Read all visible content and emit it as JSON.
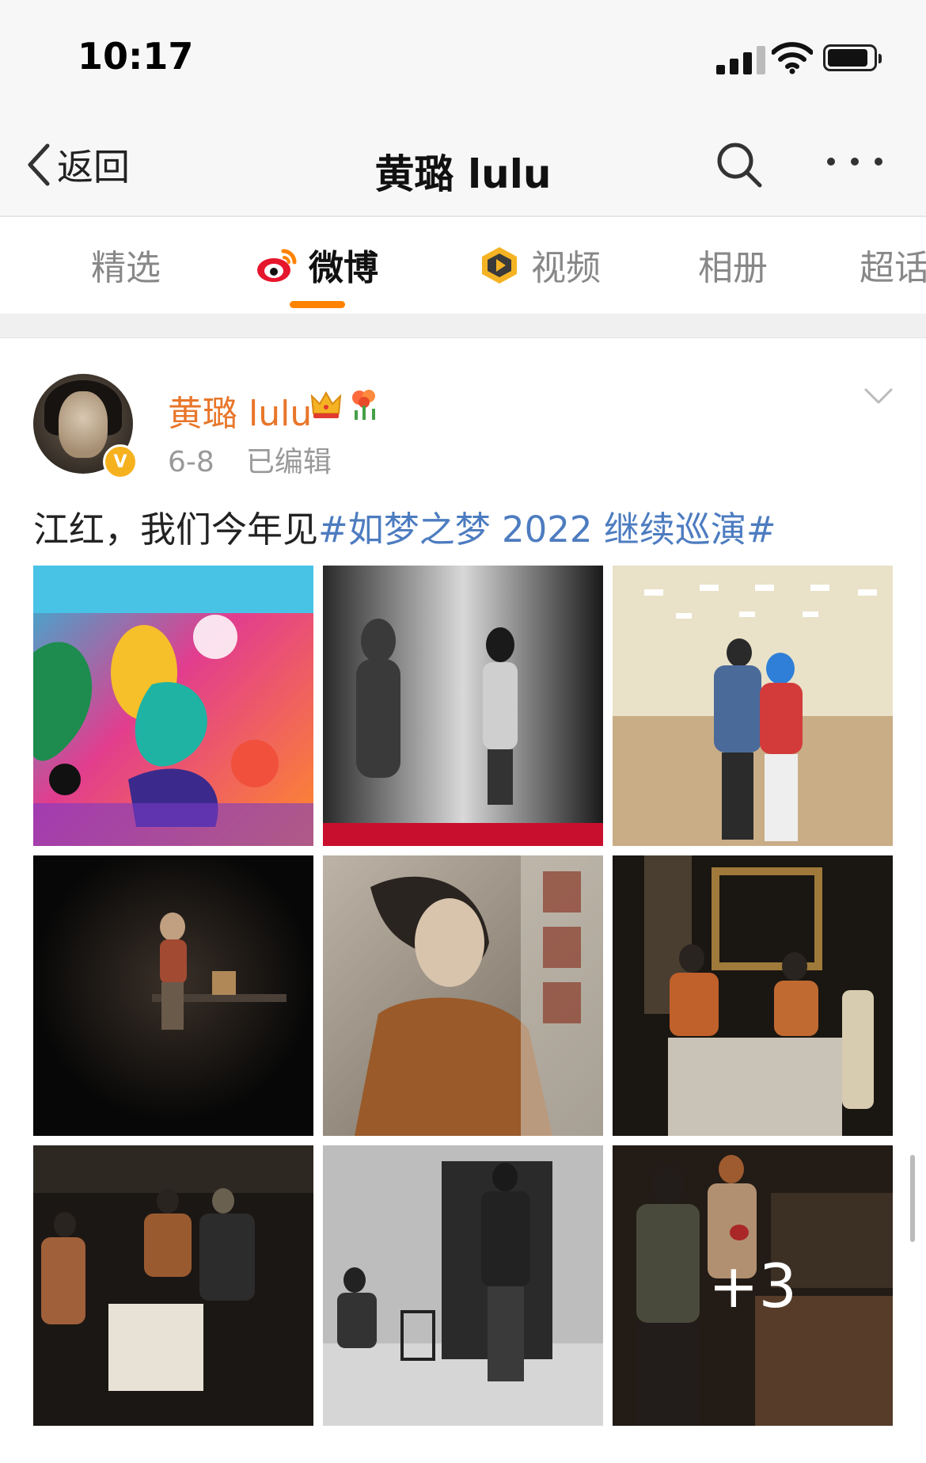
{
  "status_bar": {
    "time": "10:17",
    "battery_level": 0.9,
    "signal_bars": 3
  },
  "nav": {
    "back_label": "返回",
    "title": "黄璐 lulu"
  },
  "tabs": [
    {
      "label": "精选",
      "icon": ""
    },
    {
      "label": "微博",
      "icon": "weibo-icon",
      "active": true
    },
    {
      "label": "视频",
      "icon": "video-icon"
    },
    {
      "label": "相册",
      "icon": ""
    },
    {
      "label": "超话",
      "icon": ""
    }
  ],
  "colors": {
    "accent": "#ff8200",
    "username": "#e8762a",
    "hashtag": "#4d7cc0",
    "meta": "#999999",
    "badge": "#f6b21e"
  },
  "post": {
    "username": "黄璐 lulu",
    "verified_badge": "V",
    "date": "6-8",
    "edited": "已编辑",
    "text": "江红，我们今年见",
    "hashtag": "#如梦之梦 2022 继续巡演#",
    "photos": [
      {
        "label": "",
        "desc_icon": "colorful-poster-photo"
      },
      {
        "label": "",
        "desc_icon": "shadow-poster-photo"
      },
      {
        "label": "",
        "desc_icon": "rehearsal-hall-photo"
      },
      {
        "label": "",
        "desc_icon": "stage-spotlight-photo"
      },
      {
        "label": "",
        "desc_icon": "portrait-poster-photo"
      },
      {
        "label": "",
        "desc_icon": "stage-dinner-photo"
      },
      {
        "label": "",
        "desc_icon": "stage-group-photo"
      },
      {
        "label": "",
        "desc_icon": "bw-rehearsal-photo"
      },
      {
        "label": "+3",
        "desc_icon": "stage-bar-photo"
      }
    ]
  }
}
